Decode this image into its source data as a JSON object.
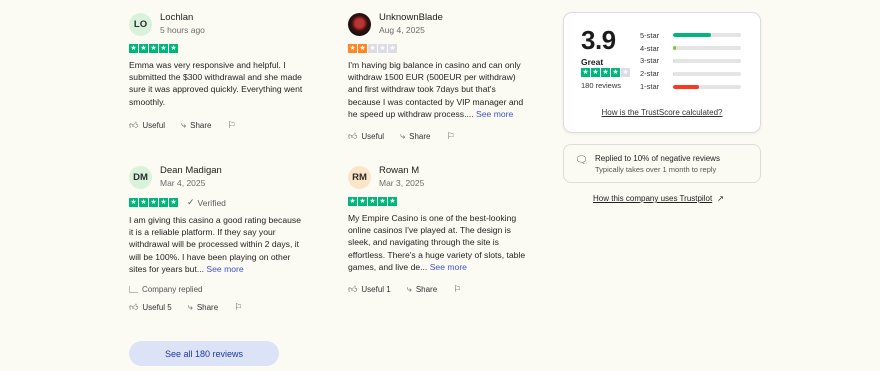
{
  "reviews": [
    {
      "initials": "LO",
      "avatar_color": "#d9f2dc",
      "name": "Lochlan",
      "date": "5 hours ago",
      "rating": 5,
      "verified": "",
      "body": "Emma was very responsive and helpful. I submitted the $300 withdrawal and she made sure it was approved quickly. Everything went smoothly.",
      "see_more": "",
      "replied": "",
      "useful": "Useful",
      "share": "Share"
    },
    {
      "initials": "",
      "avatar_color": "#3a1010",
      "name": "UnknownBlade",
      "date": "Aug 4, 2025",
      "rating": 2,
      "verified": "",
      "body": "I'm having big balance in casino and can only withdraw 1500 EUR (500EUR per withdraw) and first withdraw took 7days but that's because I was contacted by VIP manager and he speed up withdraw process....",
      "see_more": "See more",
      "replied": "",
      "useful": "Useful",
      "share": "Share"
    },
    {
      "initials": "DM",
      "avatar_color": "#d9f2dc",
      "name": "Dean Madigan",
      "date": "Mar 4, 2025",
      "rating": 5,
      "verified": "Verified",
      "body": "I am giving this casino a good rating because it is a reliable platform. If they say your withdrawal will be processed within 2 days, it will be 100%. I have been playing on other sites for years but...",
      "see_more": "See more",
      "replied": "Company replied",
      "useful": "Useful 5",
      "share": "Share"
    },
    {
      "initials": "RM",
      "avatar_color": "#fbe5c8",
      "name": "Rowan M",
      "date": "Mar 3, 2025",
      "rating": 5,
      "verified": "",
      "body": "My Empire Casino is one of the best-looking online casinos I've played at. The design is sleek, and navigating through the site is effortless. There's a huge variety of slots, table games, and live de...",
      "see_more": "See more",
      "replied": "",
      "useful": "Useful 1",
      "share": "Share"
    }
  ],
  "see_all_label": "See all 180 reviews",
  "summary": {
    "score": "3.9",
    "label": "Great",
    "stars": 4,
    "count": "180 reviews",
    "how_calculated": "How is the TrustScore calculated?",
    "distribution": [
      {
        "label": "5-star",
        "fraction": 0.56,
        "color": "#00b67a"
      },
      {
        "label": "4-star",
        "fraction": 0.05,
        "color": "#73cf11"
      },
      {
        "label": "3-star",
        "fraction": 0.01,
        "color": "#cfcfcf"
      },
      {
        "label": "2-star",
        "fraction": 0.01,
        "color": "#cfcfcf"
      },
      {
        "label": "1-star",
        "fraction": 0.38,
        "color": "#ff3722"
      }
    ]
  },
  "reply_info": {
    "title": "Replied to 10% of negative reviews",
    "subtitle": "Typically takes over 1 month to reply"
  },
  "how_uses": "How this company uses Trustpilot",
  "colors": {
    "star_green": "#00b67a",
    "star_orange": "#ff8622",
    "star_empty": "#dcdce6",
    "link_blue": "#3a55c8"
  }
}
